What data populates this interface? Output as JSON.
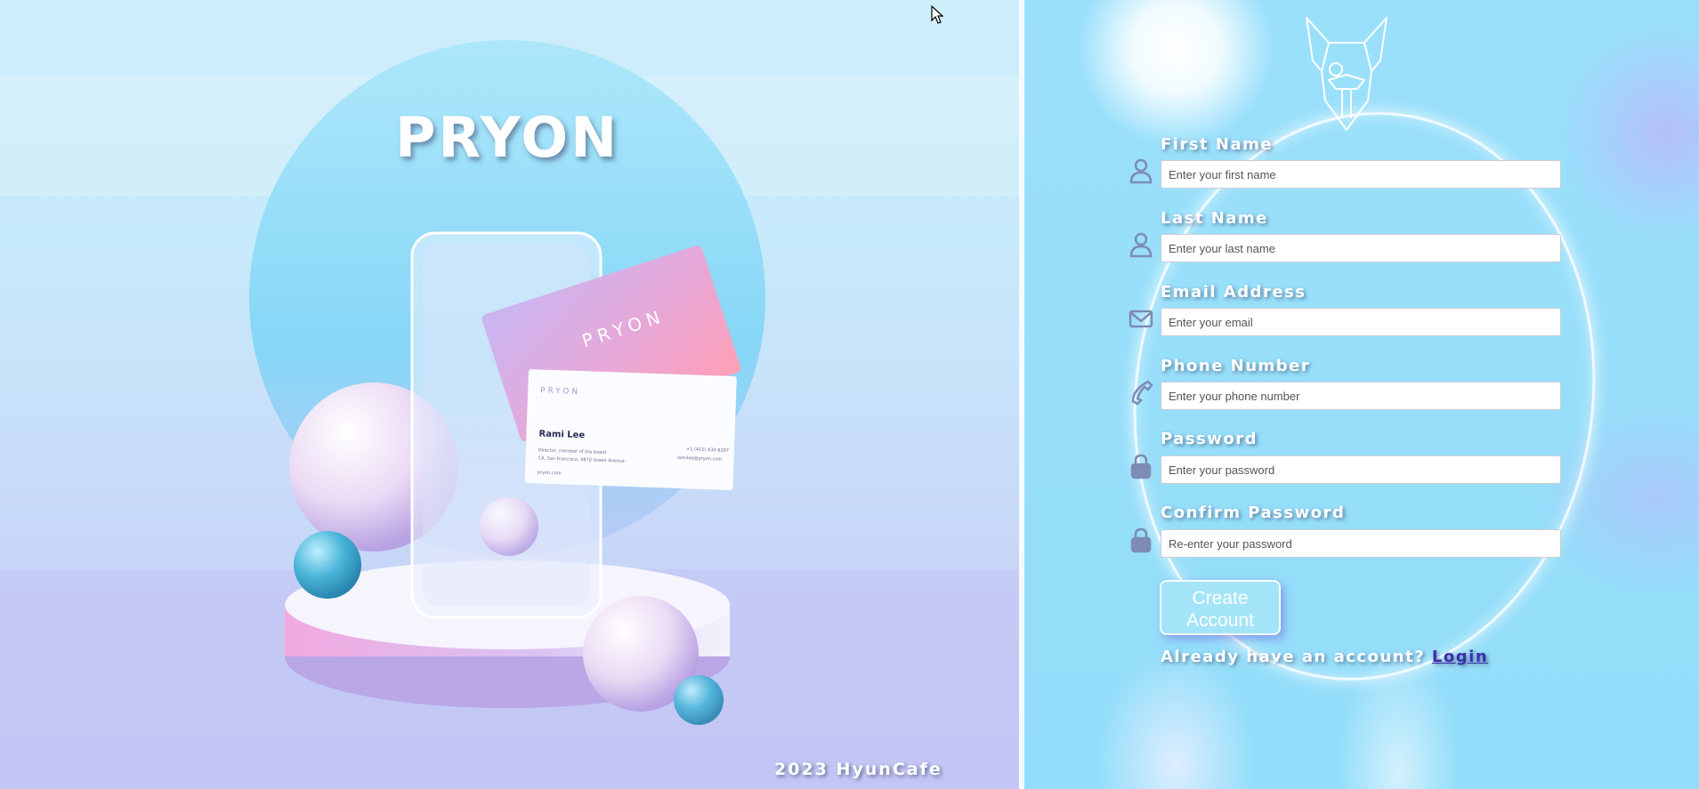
{
  "brand": {
    "title": "PRYON"
  },
  "footer": {
    "text": "2023 HyunCafe"
  },
  "business_card": {
    "logo": "PRYON",
    "name": "Rami Lee",
    "line1": "Director, member of the board",
    "line2": "CA, San Francisco, 4870 Green Avenue",
    "phone": "+1 (415) 430-8287",
    "email": "ramilee@pryon.com",
    "site": "pryon.com"
  },
  "back_card": {
    "logo": "PRYON"
  },
  "form": {
    "fields": [
      {
        "label": "First Name",
        "placeholder": "Enter your first name",
        "icon": "user-icon"
      },
      {
        "label": "Last Name",
        "placeholder": "Enter your last name",
        "icon": "user-icon"
      },
      {
        "label": "Email Address",
        "placeholder": "Enter your email",
        "icon": "envelope-icon"
      },
      {
        "label": "Phone Number",
        "placeholder": "Enter your phone number",
        "icon": "phone-icon"
      },
      {
        "label": "Password",
        "placeholder": "Enter your password",
        "icon": "lock-icon"
      },
      {
        "label": "Confirm Password",
        "placeholder": "Re-enter your password",
        "icon": "lock-icon"
      }
    ],
    "submit_label": "Create Account",
    "login_prompt": "Already have an account?",
    "login_link": "Login"
  },
  "colors": {
    "accent": "#3b2fae",
    "panel_bg": "#9be0fb",
    "button_bg": "#a4e4f8"
  }
}
